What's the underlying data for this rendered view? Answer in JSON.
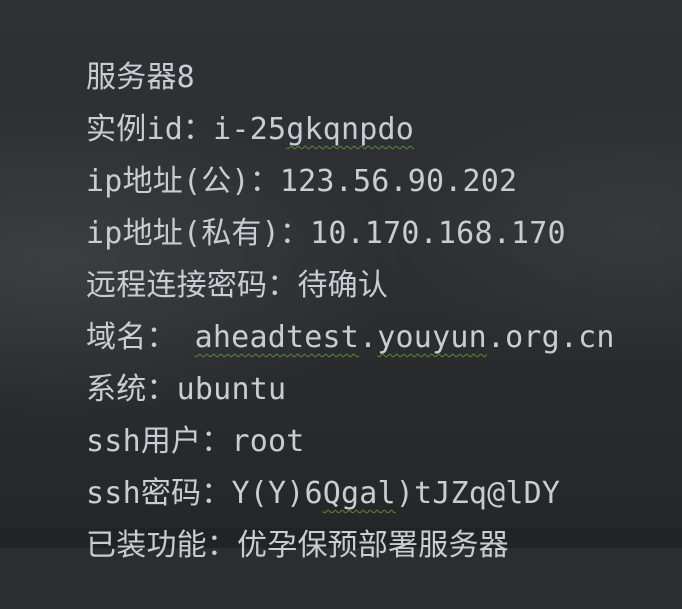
{
  "lines": {
    "server": "服务器8",
    "instance_label": "实例id：",
    "instance_prefix": "i-25",
    "instance_suffix": "gkqnpdo",
    "ip_public_label": "ip地址(公)：",
    "ip_public_value": "123.56.90.202",
    "ip_private_label": "ip地址(私有)：",
    "ip_private_value": "10.170.168.170",
    "remote_password_label": "远程连接密码：",
    "remote_password_value": "待确认",
    "domain_label": "域名：",
    "domain_first": "aheadtest",
    "domain_dot_1": ".",
    "domain_second": "youyun",
    "domain_tail": ".org.cn",
    "system_label": "系统：",
    "system_value": "ubuntu",
    "ssh_user_label": "ssh用户：",
    "ssh_user_value": "root",
    "ssh_password_label": "ssh密码：",
    "ssh_password_prefix": "Y(Y)6",
    "ssh_password_mid": "Qgal",
    "ssh_password_suffix": ")tJZq@lDY",
    "installed_label": "已装功能：",
    "installed_value": "优孕保预部署服务器"
  }
}
